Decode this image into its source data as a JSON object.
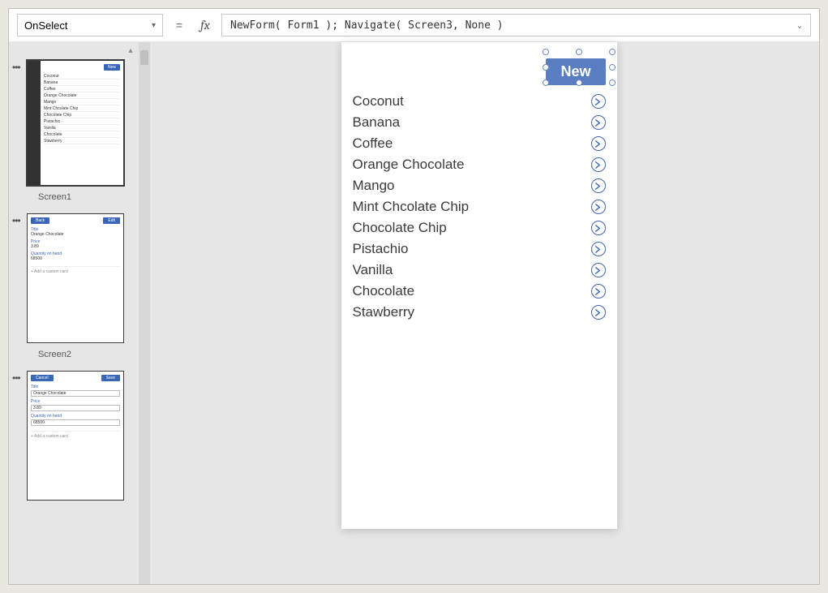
{
  "formulaBar": {
    "property": "OnSelect",
    "fxLabel": "fx",
    "formula": "NewForm( Form1 ); Navigate( Screen3, None )"
  },
  "screens": {
    "labels": [
      "Screen1",
      "Screen2"
    ],
    "thumb1": {
      "newLabel": "New",
      "items": [
        "Coconut",
        "Banana",
        "Coffee",
        "Orange Chocolate",
        "Mango",
        "Mint Chcolate Chip",
        "Chocolate Chip",
        "Pistachio",
        "Vanilla",
        "Chocolate",
        "Stawberry"
      ]
    },
    "thumb2": {
      "back": "Back",
      "edit": "Edit",
      "titleLbl": "Title",
      "titleVal": "Orange Chocolate",
      "priceLbl": "Price",
      "priceVal": "3.89",
      "qtyLbl": "Quantity on hand",
      "qtyVal": "68500",
      "add": "+  Add a custom card"
    },
    "thumb3": {
      "cancel": "Cancel",
      "save": "Save",
      "titleLbl": "Title",
      "titleVal": "Orange Chocolate",
      "priceLbl": "Price",
      "priceVal": "3.89",
      "qtyLbl": "Quantity on hand",
      "qtyVal": "68500",
      "add": "+  Add a custom card"
    }
  },
  "canvas": {
    "newButton": "New",
    "gallery": [
      "Coconut",
      "Banana",
      "Coffee",
      "Orange Chocolate",
      "Mango",
      "Mint Chcolate Chip",
      "Chocolate Chip",
      "Pistachio",
      "Vanilla",
      "Chocolate",
      "Stawberry"
    ]
  }
}
